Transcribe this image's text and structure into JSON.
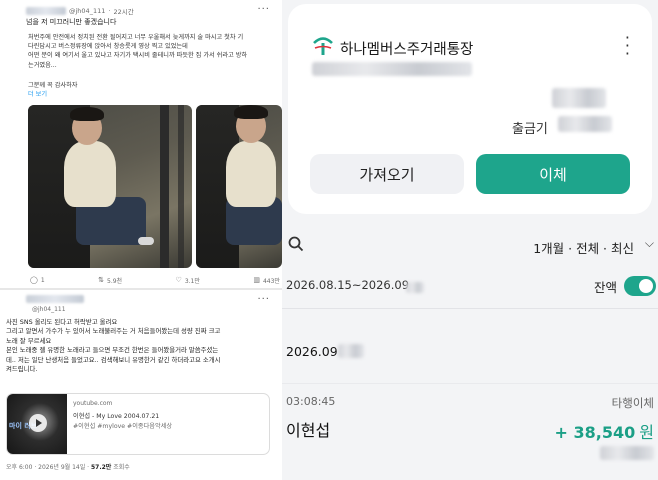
{
  "social": {
    "post1": {
      "handle": "@jh04_111",
      "time": "22시간",
      "title": "넘을 저 미끄러니만 좋겠습니다",
      "body_lines": [
        "처번주에 안전에서 정치된 전환 될어지고 너무 우울해서 늦게까지 술 마시고 첫차 기",
        "다린답시고 버스정류장에 앉아서 창승릇게 영상 찍고 있었는데",
        "어떤 분이 왜 여기서 울고 있냐고 자기가 택시비 줄테니까 따듯한 집 가서 쉬라고 방하",
        "는거였음..."
      ],
      "sub_line": "그분께 꼭 감사하자",
      "more": "더 보기",
      "stats": {
        "replies": "1",
        "reposts": "5.9천",
        "likes": "3.1만",
        "views": "443만"
      }
    },
    "post2": {
      "handle": "@jh04_111",
      "body_lines": [
        "사진 SNS 올리도 된다고 허락받고 올려요",
        "그리고 알면서 가수가 누 있어서 노래불러주는 거 처음들어봤는데 성량 진짜 크고",
        "노래 잘 부르세요",
        "본인 노래중 젤 유명한 노래라고 들으면 무조건 한번은 들어봤을거라 말씀주셨는",
        "데.. 저는 일단 난생처음 들었고요.. 검색해보니 유명한거 같긴 하더라고요 소개시",
        "켜드립니다."
      ],
      "link": {
        "domain": "youtube.com",
        "title": "이현섭 - My Love 2004.07.21",
        "tags": "#이현섭 #mylove #이종다음악세상",
        "thumb_badge": "마이 러브"
      },
      "meta_time": "오후 6:00 · 2026년 9월 14일 · ",
      "meta_views": "57.2만",
      "meta_views_label": " 조회수"
    }
  },
  "bank": {
    "account_name": "하나멤버스주거래통장",
    "withdraw_label": "출금기",
    "fetch_button": "가져오기",
    "transfer_button": "이체",
    "filter": "1개월 · 전체 · 최신",
    "date_range": "2026.08.15~2026.09",
    "balance_toggle_label": "잔액",
    "balance_toggle_on": true,
    "transaction": {
      "date": "2026.09",
      "time": "03:08:45",
      "type": "타행이체",
      "name": "이현섭",
      "amount": "+ 38,540",
      "unit": "원"
    },
    "colors": {
      "accent": "#1ea58c",
      "amount": "#1b9f86"
    }
  }
}
